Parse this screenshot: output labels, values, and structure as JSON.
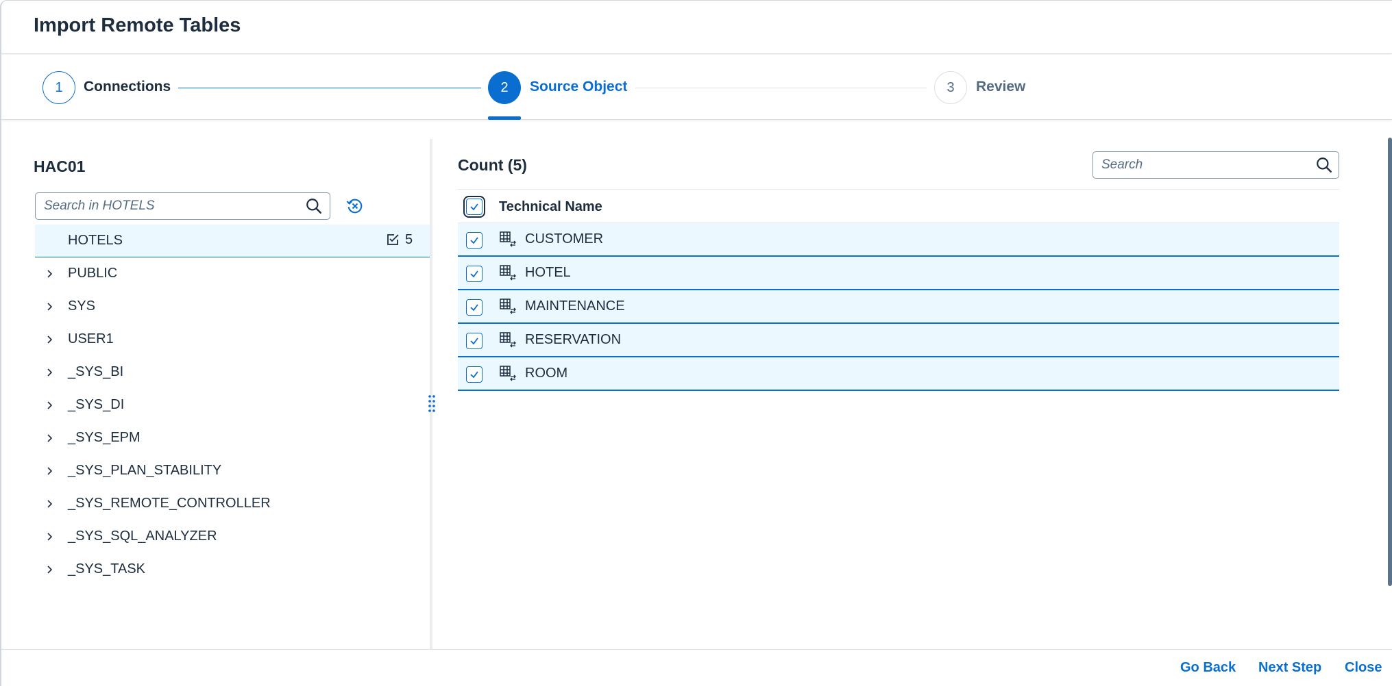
{
  "dialog": {
    "title": "Import Remote Tables"
  },
  "wizard": {
    "steps": [
      {
        "number": "1",
        "label": "Connections",
        "state": "completed"
      },
      {
        "number": "2",
        "label": "Source Object",
        "state": "active"
      },
      {
        "number": "3",
        "label": "Review",
        "state": "pending"
      }
    ]
  },
  "left": {
    "title": "HAC01",
    "search_placeholder": "Search in HOTELS",
    "tree": [
      {
        "label": "HOTELS",
        "selected": true,
        "count": "5"
      },
      {
        "label": "PUBLIC"
      },
      {
        "label": "SYS"
      },
      {
        "label": "USER1"
      },
      {
        "label": "_SYS_BI"
      },
      {
        "label": "_SYS_DI"
      },
      {
        "label": "_SYS_EPM"
      },
      {
        "label": "_SYS_PLAN_STABILITY"
      },
      {
        "label": "_SYS_REMOTE_CONTROLLER"
      },
      {
        "label": "_SYS_SQL_ANALYZER"
      },
      {
        "label": "_SYS_TASK"
      }
    ]
  },
  "right": {
    "count_title": "Count (5)",
    "search_placeholder": "Search",
    "column_header": "Technical Name",
    "rows": [
      {
        "name": "CUSTOMER",
        "checked": true
      },
      {
        "name": "HOTEL",
        "checked": true
      },
      {
        "name": "MAINTENANCE",
        "checked": true
      },
      {
        "name": "RESERVATION",
        "checked": true
      },
      {
        "name": "ROOM",
        "checked": true
      }
    ]
  },
  "footer": {
    "go_back": "Go Back",
    "next_step": "Next Step",
    "close": "Close"
  },
  "colors": {
    "accent": "#0a6ed1",
    "selected_row": "#ebf8ff",
    "text": "#1d2d3e"
  }
}
